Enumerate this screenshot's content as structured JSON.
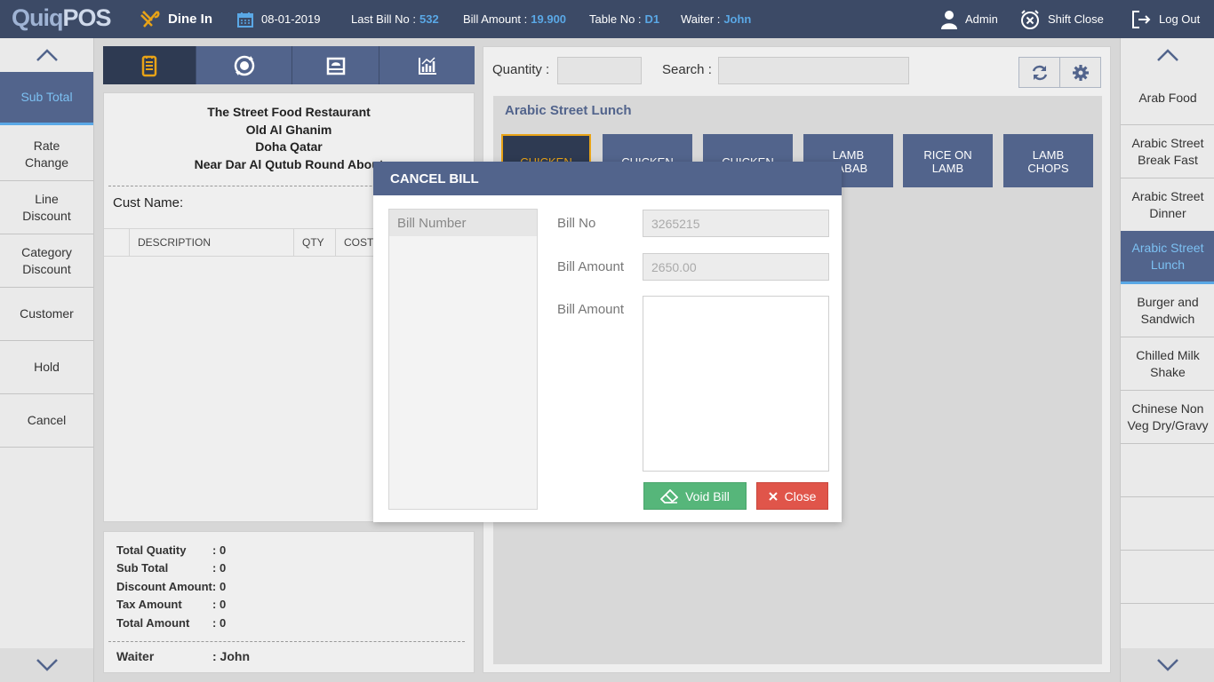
{
  "app": {
    "logo_quiq": "Quiq",
    "logo_pos": "POS"
  },
  "topbar": {
    "mode": "Dine In",
    "date": "08-01-2019",
    "last_bill_label": "Last Bill No :",
    "last_bill_value": "532",
    "bill_amount_label": "Bill Amount :",
    "bill_amount_value": "19.900",
    "table_label": "Table No :",
    "table_value": "D1",
    "waiter_label": "Waiter :",
    "waiter_value": "John",
    "user": "Admin",
    "shift_close": "Shift Close",
    "logout": "Log Out"
  },
  "left_sidebar": {
    "items": [
      {
        "label": "Sub Total"
      },
      {
        "label": "Rate\nChange"
      },
      {
        "label": "Line\nDiscount"
      },
      {
        "label": "Category\nDiscount"
      },
      {
        "label": "Customer"
      },
      {
        "label": "Hold"
      },
      {
        "label": "Cancel"
      }
    ]
  },
  "receipt": {
    "restaurant_name": "The Street Food Restaurant",
    "address_line1": "Old Al Ghanim",
    "address_line2": "Doha Qatar",
    "address_line3": "Near Dar Al Qutub Round About",
    "cust_name_label": "Cust Name:",
    "columns": [
      "DESCRIPTION",
      "QTY",
      "COST"
    ]
  },
  "totals": {
    "total_quantity_label": "Total Quatity",
    "total_quantity_value": ": 0",
    "sub_total_label": "Sub Total",
    "sub_total_value": ": 0",
    "discount_label": "Discount Amount:",
    "discount_value": "0",
    "tax_label": "Tax Amount",
    "tax_value": ": 0",
    "total_amount_label": "Total Amount",
    "total_amount_value": ": 0",
    "waiter_label": "Waiter",
    "waiter_value": ": John"
  },
  "products": {
    "quantity_label": "Quantity :",
    "search_label": "Search :",
    "category_title": "Arabic Street Lunch",
    "items": [
      {
        "label": "CHICKEN"
      },
      {
        "label": "CHICKEN"
      },
      {
        "label": "CHICKEN"
      },
      {
        "label": "LAMB\nKABAB"
      },
      {
        "label": "RICE ON\nLAMB"
      },
      {
        "label": "LAMB\nCHOPS"
      }
    ]
  },
  "right_sidebar": {
    "items": [
      {
        "label": "Arab Food"
      },
      {
        "label": "Arabic Street\nBreak Fast"
      },
      {
        "label": "Arabic Street\nDinner"
      },
      {
        "label": "Arabic Street\nLunch"
      },
      {
        "label": "Burger and\nSandwich"
      },
      {
        "label": "Chilled Milk\nShake"
      },
      {
        "label": "Chinese Non\nVeg Dry/Gravy"
      },
      {
        "label": ""
      },
      {
        "label": ""
      },
      {
        "label": ""
      }
    ]
  },
  "modal": {
    "title": "CANCEL BILL",
    "list_header": "Bill Number",
    "bill_no_label": "Bill No",
    "bill_no_placeholder": "3265215",
    "bill_amount_label": "Bill Amount",
    "bill_amount_placeholder": "2650.00",
    "bill_amount_label2": "Bill Amount",
    "void_button": "Void Bill",
    "close_button": "Close"
  },
  "colors": {
    "topbar": "#3c4a66",
    "primary": "#52648c",
    "accent_blue": "#5aa8e6",
    "selected_orange": "#e8a317",
    "void_green": "#56b67a",
    "close_red": "#e0554a"
  }
}
